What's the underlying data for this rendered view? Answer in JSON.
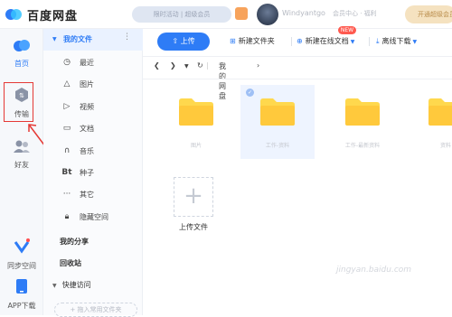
{
  "app": {
    "name": "百度网盘",
    "brand_color": "#2e7cf6"
  },
  "header": {
    "promo_text": "限时活动 | 超级会员",
    "username": "Windyantgo",
    "member_text": "会员中心 · 福利",
    "vip_button": "开通超级会员"
  },
  "left_nav": [
    {
      "label": "首页",
      "icon": "cloud-icon",
      "active": true
    },
    {
      "label": "传输",
      "icon": "transfer-icon",
      "active": false
    },
    {
      "label": "好友",
      "icon": "friends-icon",
      "active": false
    },
    {
      "label": "同步空间",
      "icon": "sync-icon",
      "active": false
    },
    {
      "label": "APP下载",
      "icon": "phone-icon",
      "active": false
    }
  ],
  "sidebar": {
    "header": "我的文件",
    "items": [
      {
        "label": "最近",
        "icon": "clock-icon"
      },
      {
        "label": "图片",
        "icon": "image-icon"
      },
      {
        "label": "视频",
        "icon": "video-icon"
      },
      {
        "label": "文档",
        "icon": "document-icon"
      },
      {
        "label": "音乐",
        "icon": "music-icon"
      },
      {
        "label": "种子",
        "icon": "torrent-icon"
      },
      {
        "label": "其它",
        "icon": "more-icon"
      },
      {
        "label": "隐藏空间",
        "icon": "lock-icon"
      }
    ],
    "my_share": "我的分享",
    "recycle": "回收站",
    "quick_access": "快捷访问",
    "quick_add": "+ 拖入常用文件夹"
  },
  "toolbar": {
    "upload": "上传",
    "new_folder": "新建文件夹",
    "new_online_doc": "新建在线文档",
    "new_badge": "NEW",
    "offline_download": "离线下载"
  },
  "breadcrumb": {
    "current": "我的网盘"
  },
  "files": [
    {
      "name": "图片",
      "selected": false
    },
    {
      "name": "工作-资料",
      "selected": true
    },
    {
      "name": "工作-最新资料",
      "selected": false
    },
    {
      "name": "资料",
      "selected": false
    }
  ],
  "upload_tile": {
    "label": "上传文件"
  },
  "watermark": "jingyan.baidu.com"
}
